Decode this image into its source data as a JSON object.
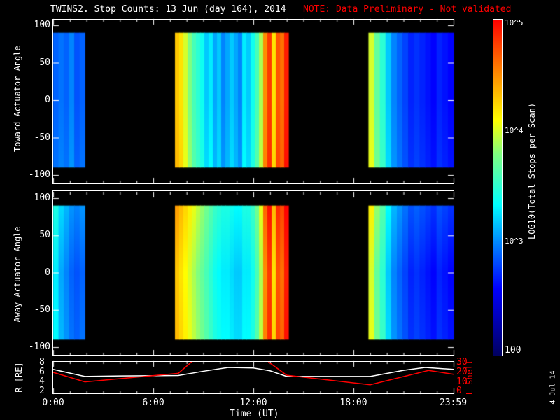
{
  "title": "TWINS2. Stop Counts: 13 Jun (day 164), 2014",
  "note": "NOTE: Data Preliminary - Not validated",
  "date_stamp": "4 Jul 14",
  "colors": {
    "note": "#ff0000",
    "lshell": "#ff0000",
    "r": "#ffffff"
  },
  "chart_data": [
    {
      "type": "heatmap",
      "ylabel": "Toward Actuator Angle",
      "ylim": [
        -100,
        100
      ],
      "yticks": [
        "100",
        "50",
        "0",
        "-50",
        "-100"
      ],
      "x_range_hours": [
        0,
        24
      ],
      "blocks": [
        {
          "start": 0,
          "end": 1.9,
          "levels": [
            2.9,
            2.95,
            2.9,
            3.0,
            2.85,
            2.9
          ]
        },
        {
          "start": 7.3,
          "end": 14.1,
          "levels": [
            4.3,
            4.2,
            4.0,
            3.8,
            3.6,
            3.5,
            3.4,
            3.2,
            3.3,
            3.1,
            3.2,
            3.0,
            3.1,
            3.2,
            3.1,
            3.0,
            3.3,
            3.2,
            3.4,
            3.6,
            3.9,
            4.5,
            4.8,
            4.2,
            4.7,
            4.6,
            4.9
          ]
        },
        {
          "start": 18.9,
          "end": 24,
          "levels": [
            4.0,
            3.7,
            3.5,
            3.2,
            3.0,
            2.9,
            2.8,
            2.7,
            2.75,
            2.7,
            2.65,
            2.6,
            2.7,
            2.65,
            2.6
          ]
        }
      ]
    },
    {
      "type": "heatmap",
      "ylabel": "Away Actuator Angle",
      "ylim": [
        -100,
        100
      ],
      "yticks": [
        "100",
        "50",
        "0",
        "-50",
        "-100"
      ],
      "x_range_hours": [
        0,
        24
      ],
      "blocks": [
        {
          "start": 0,
          "end": 1.9,
          "levels": [
            3.3,
            3.1,
            3.0,
            2.9,
            2.85,
            2.9
          ]
        },
        {
          "start": 7.3,
          "end": 14.1,
          "levels": [
            4.3,
            4.2,
            4.1,
            4.0,
            3.9,
            3.8,
            3.7,
            3.6,
            3.5,
            3.4,
            3.35,
            3.3,
            3.3,
            3.25,
            3.2,
            3.2,
            3.3,
            3.3,
            3.4,
            3.6,
            3.9,
            4.5,
            4.8,
            4.2,
            4.7,
            4.6,
            4.9
          ]
        },
        {
          "start": 18.9,
          "end": 24,
          "levels": [
            4.0,
            3.7,
            3.5,
            3.2,
            3.0,
            2.9,
            2.8,
            2.7,
            2.75,
            2.7,
            2.65,
            2.6,
            2.7,
            2.65,
            2.6
          ]
        }
      ]
    },
    {
      "type": "line",
      "ylabel": "R [RE]",
      "y2label": "L Shell",
      "xlabel": "Time (UT)",
      "xticks": [
        "0:00",
        "6:00",
        "12:00",
        "18:00",
        "23:59"
      ],
      "yticks": [
        "8",
        "6",
        "4",
        "2"
      ],
      "y2ticks": [
        "30",
        "20",
        "10",
        "0"
      ],
      "ylim": [
        1.5,
        8.2
      ],
      "y2lim": [
        -2,
        31
      ],
      "series": [
        {
          "name": "R",
          "x": [
            0,
            1.9,
            4,
            7.5,
            9,
            10.5,
            12,
            13,
            14,
            16,
            19,
            21,
            22.3,
            24
          ],
          "y": [
            6.6,
            5.1,
            5.2,
            5.3,
            6.2,
            7.0,
            6.9,
            6.3,
            5.1,
            5.1,
            5.1,
            6.4,
            7.0,
            6.6
          ]
        },
        {
          "name": "L Shell",
          "x": [
            0,
            1.9,
            7.5,
            8.3
          ],
          "y": [
            20,
            10,
            19,
            31
          ]
        },
        {
          "name": "L Shell 2",
          "x": [
            12.9,
            14,
            19,
            22.5,
            24
          ],
          "y": [
            31,
            17,
            7,
            22,
            18
          ]
        }
      ]
    },
    {
      "type": "colorbar",
      "label": "LOG10(Total Stops per Scan)",
      "ticks": [
        "10^5",
        "10^4",
        "10^3",
        "100"
      ],
      "range_log": [
        2,
        5
      ]
    }
  ]
}
